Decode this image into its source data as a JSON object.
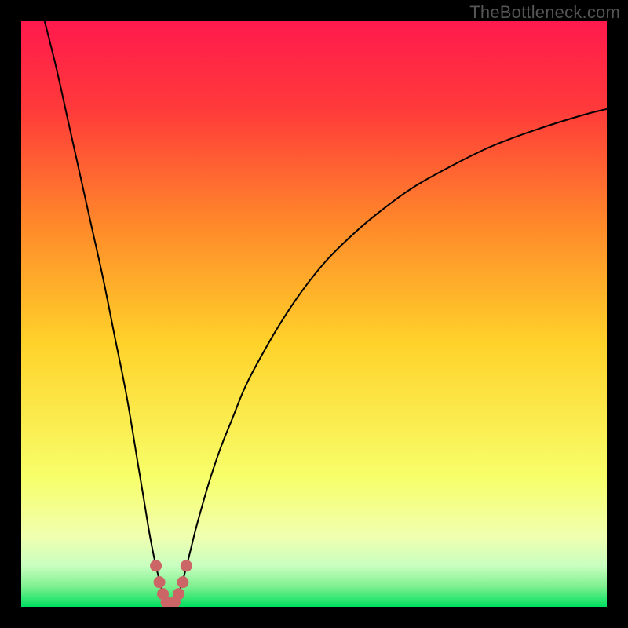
{
  "watermark": "TheBottleneck.com",
  "colors": {
    "frame_bg": "#000000",
    "gradient_top": "#ff1a4d",
    "gradient_mid_upper": "#ff7a2a",
    "gradient_mid": "#ffd22a",
    "gradient_lower": "#f7ff6a",
    "gradient_band": "#d9ffc7",
    "gradient_bottom": "#00e060",
    "curve": "#000000",
    "marker": "#cc6666"
  },
  "chart_data": {
    "type": "line",
    "title": "",
    "xlabel": "",
    "ylabel": "",
    "xlim": [
      0,
      100
    ],
    "ylim": [
      0,
      100
    ],
    "series": [
      {
        "name": "left-branch",
        "x": [
          4,
          6,
          8,
          10,
          12,
          14,
          16,
          18,
          20,
          21,
          22,
          23,
          24,
          24.5,
          25
        ],
        "y": [
          100,
          92,
          83,
          74,
          65,
          56,
          46,
          36,
          24,
          18,
          12,
          7,
          3,
          1,
          0
        ]
      },
      {
        "name": "right-branch",
        "x": [
          26,
          26.5,
          27,
          28,
          29,
          30,
          32,
          34,
          36,
          38,
          40,
          44,
          48,
          52,
          56,
          60,
          66,
          72,
          80,
          88,
          96,
          100
        ],
        "y": [
          0,
          1,
          2.5,
          6,
          10,
          14,
          21,
          27,
          32,
          37,
          41,
          48,
          54,
          59,
          63,
          66.5,
          71,
          74.5,
          78.5,
          81.5,
          84,
          85
        ]
      }
    ],
    "markers": {
      "name": "valley-markers",
      "x": [
        23.0,
        23.6,
        24.2,
        24.8,
        25.5,
        26.2,
        26.9,
        27.6,
        28.2
      ],
      "y": [
        7.0,
        4.2,
        2.2,
        0.8,
        0.2,
        0.8,
        2.2,
        4.2,
        7.0
      ]
    },
    "gradient_stops": [
      {
        "offset": 0.0,
        "color": "#ff1a4d"
      },
      {
        "offset": 0.15,
        "color": "#ff3a3a"
      },
      {
        "offset": 0.35,
        "color": "#ff8a2a"
      },
      {
        "offset": 0.55,
        "color": "#ffd22a"
      },
      {
        "offset": 0.78,
        "color": "#f7ff6a"
      },
      {
        "offset": 0.88,
        "color": "#f0ffb0"
      },
      {
        "offset": 0.93,
        "color": "#c8ffc0"
      },
      {
        "offset": 0.965,
        "color": "#80f090"
      },
      {
        "offset": 1.0,
        "color": "#00e060"
      }
    ]
  }
}
